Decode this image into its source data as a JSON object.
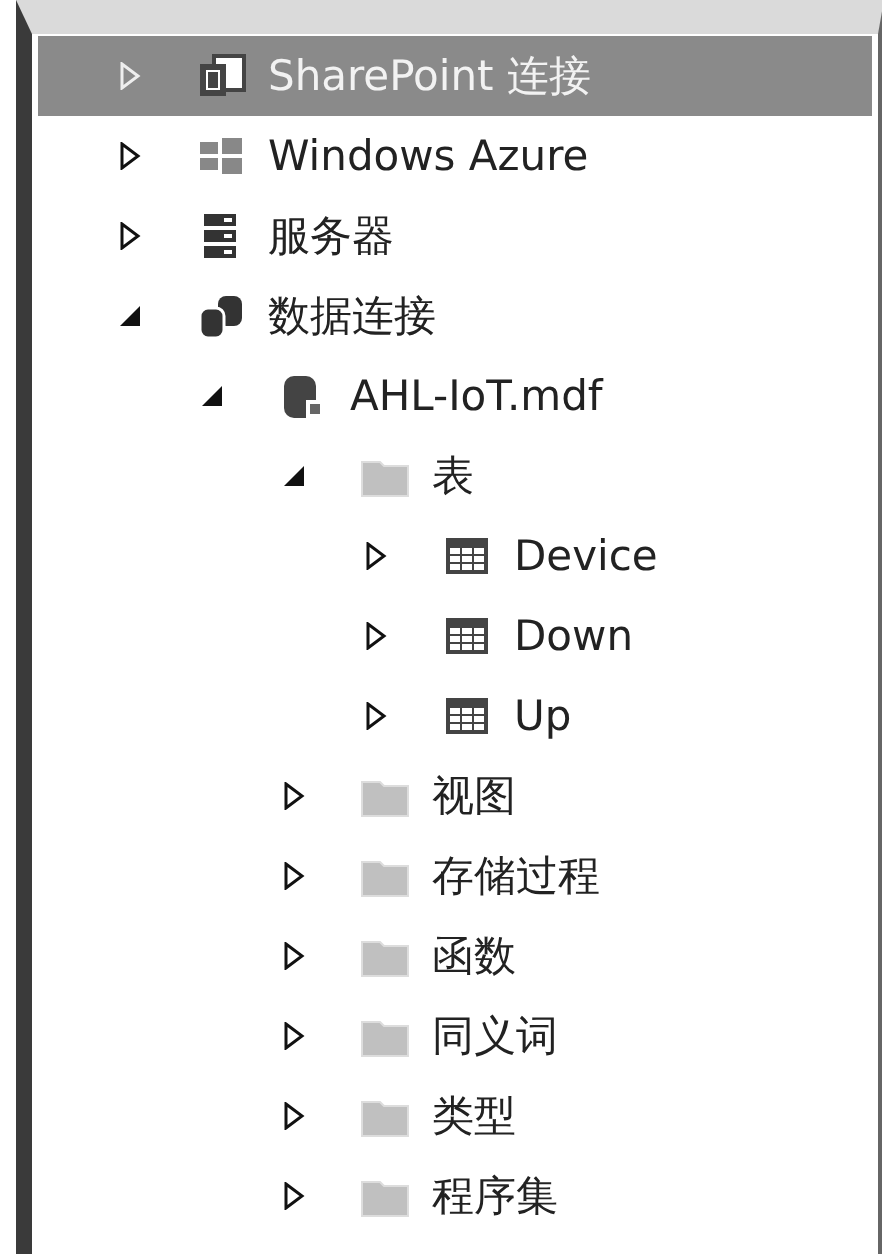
{
  "tree": [
    {
      "label": "SharePoint 连接",
      "kind": "sharepoint",
      "expanded": false,
      "selected": true
    },
    {
      "label": "Windows Azure",
      "kind": "windows",
      "expanded": false,
      "selected": false
    },
    {
      "label": "服务器",
      "kind": "server",
      "expanded": false,
      "selected": false
    },
    {
      "label": "数据连接",
      "kind": "databases",
      "expanded": true,
      "selected": false,
      "children": [
        {
          "label": "AHL-IoT.mdf",
          "kind": "database",
          "expanded": true,
          "selected": false,
          "children": [
            {
              "label": "表",
              "kind": "folder",
              "expanded": true,
              "selected": false,
              "children": [
                {
                  "label": "Device",
                  "kind": "table",
                  "expanded": false,
                  "selected": false
                },
                {
                  "label": "Down",
                  "kind": "table",
                  "expanded": false,
                  "selected": false
                },
                {
                  "label": "Up",
                  "kind": "table",
                  "expanded": false,
                  "selected": false
                }
              ]
            },
            {
              "label": "视图",
              "kind": "folder",
              "expanded": false,
              "selected": false
            },
            {
              "label": "存储过程",
              "kind": "folder",
              "expanded": false,
              "selected": false
            },
            {
              "label": "函数",
              "kind": "folder",
              "expanded": false,
              "selected": false
            },
            {
              "label": "同义词",
              "kind": "folder",
              "expanded": false,
              "selected": false
            },
            {
              "label": "类型",
              "kind": "folder",
              "expanded": false,
              "selected": false
            },
            {
              "label": "程序集",
              "kind": "folder",
              "expanded": false,
              "selected": false
            }
          ]
        }
      ]
    }
  ]
}
